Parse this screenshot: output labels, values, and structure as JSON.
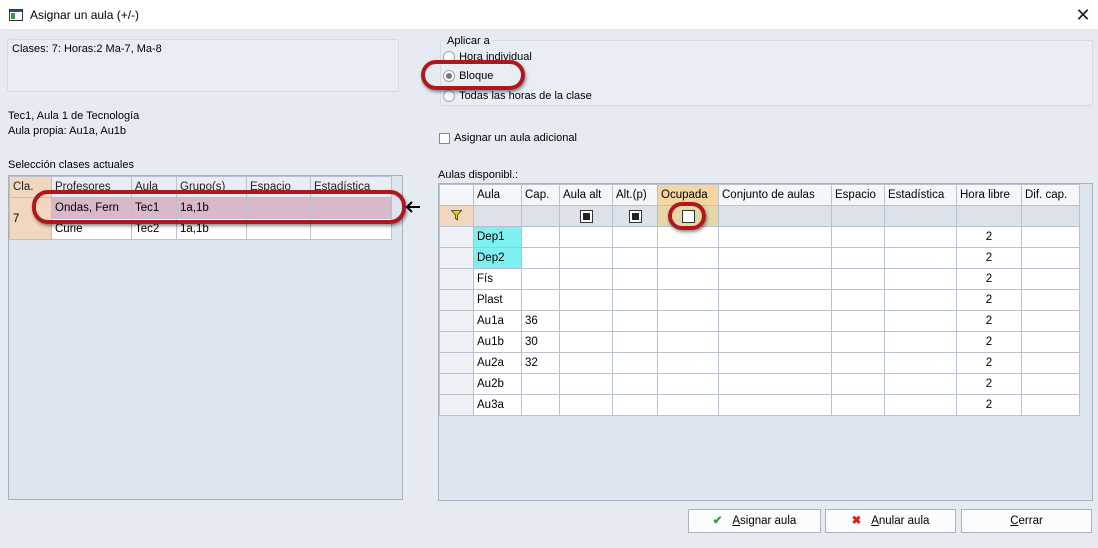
{
  "window": {
    "title": "Asignar un aula (+/-)",
    "close_glyph": "✕"
  },
  "info": {
    "clases": "Clases: 7: Horas:2 Ma-7, Ma-8",
    "line1": "Tec1, Aula 1 de Tecnología",
    "line2": "Aula propia: Au1a, Au1b"
  },
  "apply": {
    "label": "Aplicar a",
    "options": [
      {
        "label": "Hora individual",
        "selected": false
      },
      {
        "label": "Bloque",
        "selected": true
      },
      {
        "label": "Todas las horas de la clase",
        "selected": false
      }
    ]
  },
  "additional": {
    "label": "Asignar un aula adicional",
    "checked": false
  },
  "current": {
    "label": "Selección clases actuales",
    "columns": [
      "Cla.",
      "Profesores",
      "Aula",
      "Grupo(s)",
      "Espacio",
      "Estadística"
    ],
    "cla_value": "7",
    "rows": [
      {
        "profesores": "Ondas, Fern",
        "aula": "Tec1",
        "grupos": "1a,1b",
        "espacio": "",
        "estadistica": ""
      },
      {
        "profesores": "Curie",
        "aula": "Tec2",
        "grupos": "1a,1b",
        "espacio": "",
        "estadistica": ""
      }
    ]
  },
  "available": {
    "label": "Aulas disponibl.:",
    "columns": [
      "Aula",
      "Cap.",
      "Aula alt",
      "Alt.(p)",
      "Ocupada",
      "Conjunto de aulas",
      "Espacio",
      "Estadística",
      "Hora libre",
      "Dif. cap."
    ],
    "filter": {
      "aula_alt": true,
      "alt_p": true,
      "ocupada": false
    },
    "rows": [
      {
        "aula": "Dep1",
        "cap": "",
        "hora_libre": "2",
        "highlight": true
      },
      {
        "aula": "Dep2",
        "cap": "",
        "hora_libre": "2",
        "highlight": true
      },
      {
        "aula": "Fís",
        "cap": "",
        "hora_libre": "2",
        "highlight": false
      },
      {
        "aula": "Plast",
        "cap": "",
        "hora_libre": "2",
        "highlight": false
      },
      {
        "aula": "Au1a",
        "cap": "36",
        "hora_libre": "2",
        "highlight": false
      },
      {
        "aula": "Au1b",
        "cap": "30",
        "hora_libre": "2",
        "highlight": false
      },
      {
        "aula": "Au2a",
        "cap": "32",
        "hora_libre": "2",
        "highlight": false
      },
      {
        "aula": "Au2b",
        "cap": "",
        "hora_libre": "2",
        "highlight": false
      },
      {
        "aula": "Au3a",
        "cap": "",
        "hora_libre": "2",
        "highlight": false
      }
    ]
  },
  "buttons": {
    "assign": {
      "label": "Asignar aula",
      "mnemonic": "A",
      "rest": "signar aula",
      "icon": "✔"
    },
    "cancel": {
      "label": "Anular aula",
      "mnemonic": "A",
      "rest": "nular aula",
      "icon": "✖"
    },
    "close": {
      "label": "Cerrar",
      "mnemonic": "C",
      "rest": "errar"
    }
  },
  "colors": {
    "accent_red": "#b0171c",
    "header_orange": "#f5d5a0",
    "aqua": "#7ff0f0",
    "selected_row": "#d9b9c9"
  }
}
